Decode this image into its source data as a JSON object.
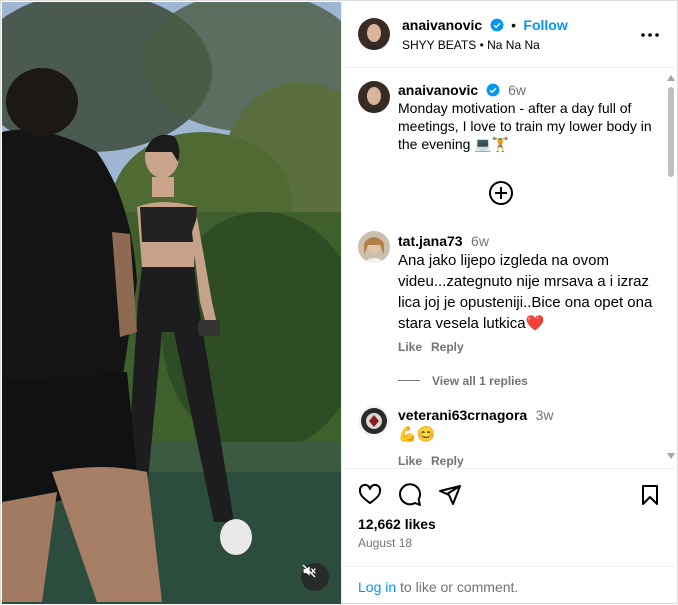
{
  "header": {
    "username": "anaivanovic",
    "follow_label": "Follow",
    "separator": "•",
    "audio": "SHYY BEATS • Na Na Na"
  },
  "caption": {
    "username": "anaivanovic",
    "ago": "6w",
    "text": "Monday motivation - after a day full of meetings, I love to train my lower body in the evening 💻🏋️"
  },
  "comments": [
    {
      "username": "tat.jana73",
      "ago": "6w",
      "text": "Ana jako lijepo izgleda na ovom videu...zategnuto nije mrsava a i izraz lica joj je opusteniji..Bice ona opet ona stara vesela lutkica❤️",
      "like_label": "Like",
      "reply_label": "Reply",
      "view_replies": "View all 1 replies"
    },
    {
      "username": "veterani63crnagora",
      "ago": "3w",
      "text": "💪😊",
      "like_label": "Like",
      "reply_label": "Reply"
    }
  ],
  "footer": {
    "likes": "12,662 likes",
    "date": "August 18",
    "login_link": "Log in",
    "login_rest": " to like or comment."
  },
  "icons": {
    "verified": "verified-badge-icon",
    "more": "more-options-icon",
    "add": "add-circle-icon",
    "like": "heart-icon",
    "comment": "comment-icon",
    "share": "share-icon",
    "save": "bookmark-icon",
    "mute": "speaker-muted-icon"
  },
  "colors": {
    "accent": "#0095f6",
    "verified": "#0095f6",
    "muted": "#737373"
  }
}
